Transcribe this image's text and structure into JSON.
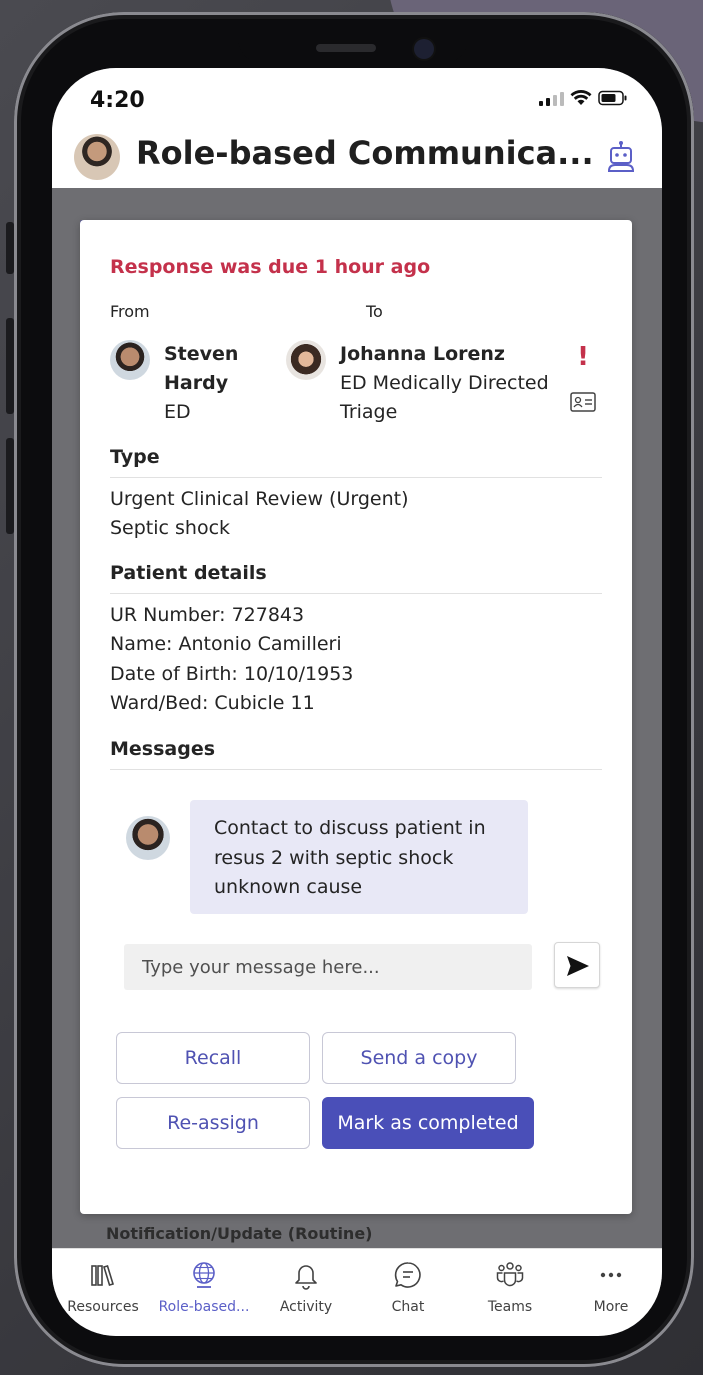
{
  "status_bar": {
    "time": "4:20"
  },
  "header": {
    "title": "Role-based Communica..."
  },
  "card": {
    "due_text": "Response was due 1 hour ago",
    "from_label": "From",
    "to_label": "To",
    "from": {
      "name_line1": "Steven",
      "name_line2": "Hardy",
      "dept": "ED"
    },
    "to": {
      "name": "Johanna Lorenz",
      "role_line1": "ED Medically Directed",
      "role_line2": "Triage"
    },
    "type_heading": "Type",
    "type_lines": [
      "Urgent Clinical Review (Urgent)",
      "Septic shock"
    ],
    "patient_heading": "Patient details",
    "patient_lines": [
      "UR Number: 727843",
      "Name: Antonio Camilleri",
      "Date of Birth: 10/10/1953",
      "Ward/Bed: Cubicle 11"
    ],
    "messages_heading": "Messages",
    "message_lines": [
      "Contact to discuss patient in",
      "resus 2 with septic shock",
      "unknown cause"
    ],
    "input_placeholder": "Type your message here...",
    "buttons": {
      "recall": "Recall",
      "send_copy": "Send a copy",
      "reassign": "Re-assign",
      "complete": "Mark as completed"
    }
  },
  "background_notice": "Notification/Update (Routine)",
  "bottom_nav": [
    {
      "label": "Resources",
      "icon": "library-icon"
    },
    {
      "label": "Role-based...",
      "icon": "globe-icon",
      "active": true
    },
    {
      "label": "Activity",
      "icon": "bell-icon"
    },
    {
      "label": "Chat",
      "icon": "chat-icon"
    },
    {
      "label": "Teams",
      "icon": "teams-icon"
    },
    {
      "label": "More",
      "icon": "more-icon"
    }
  ],
  "colors": {
    "accent": "#4a4fb8",
    "alert": "#c4314b",
    "bubble": "#e8e8f6"
  }
}
